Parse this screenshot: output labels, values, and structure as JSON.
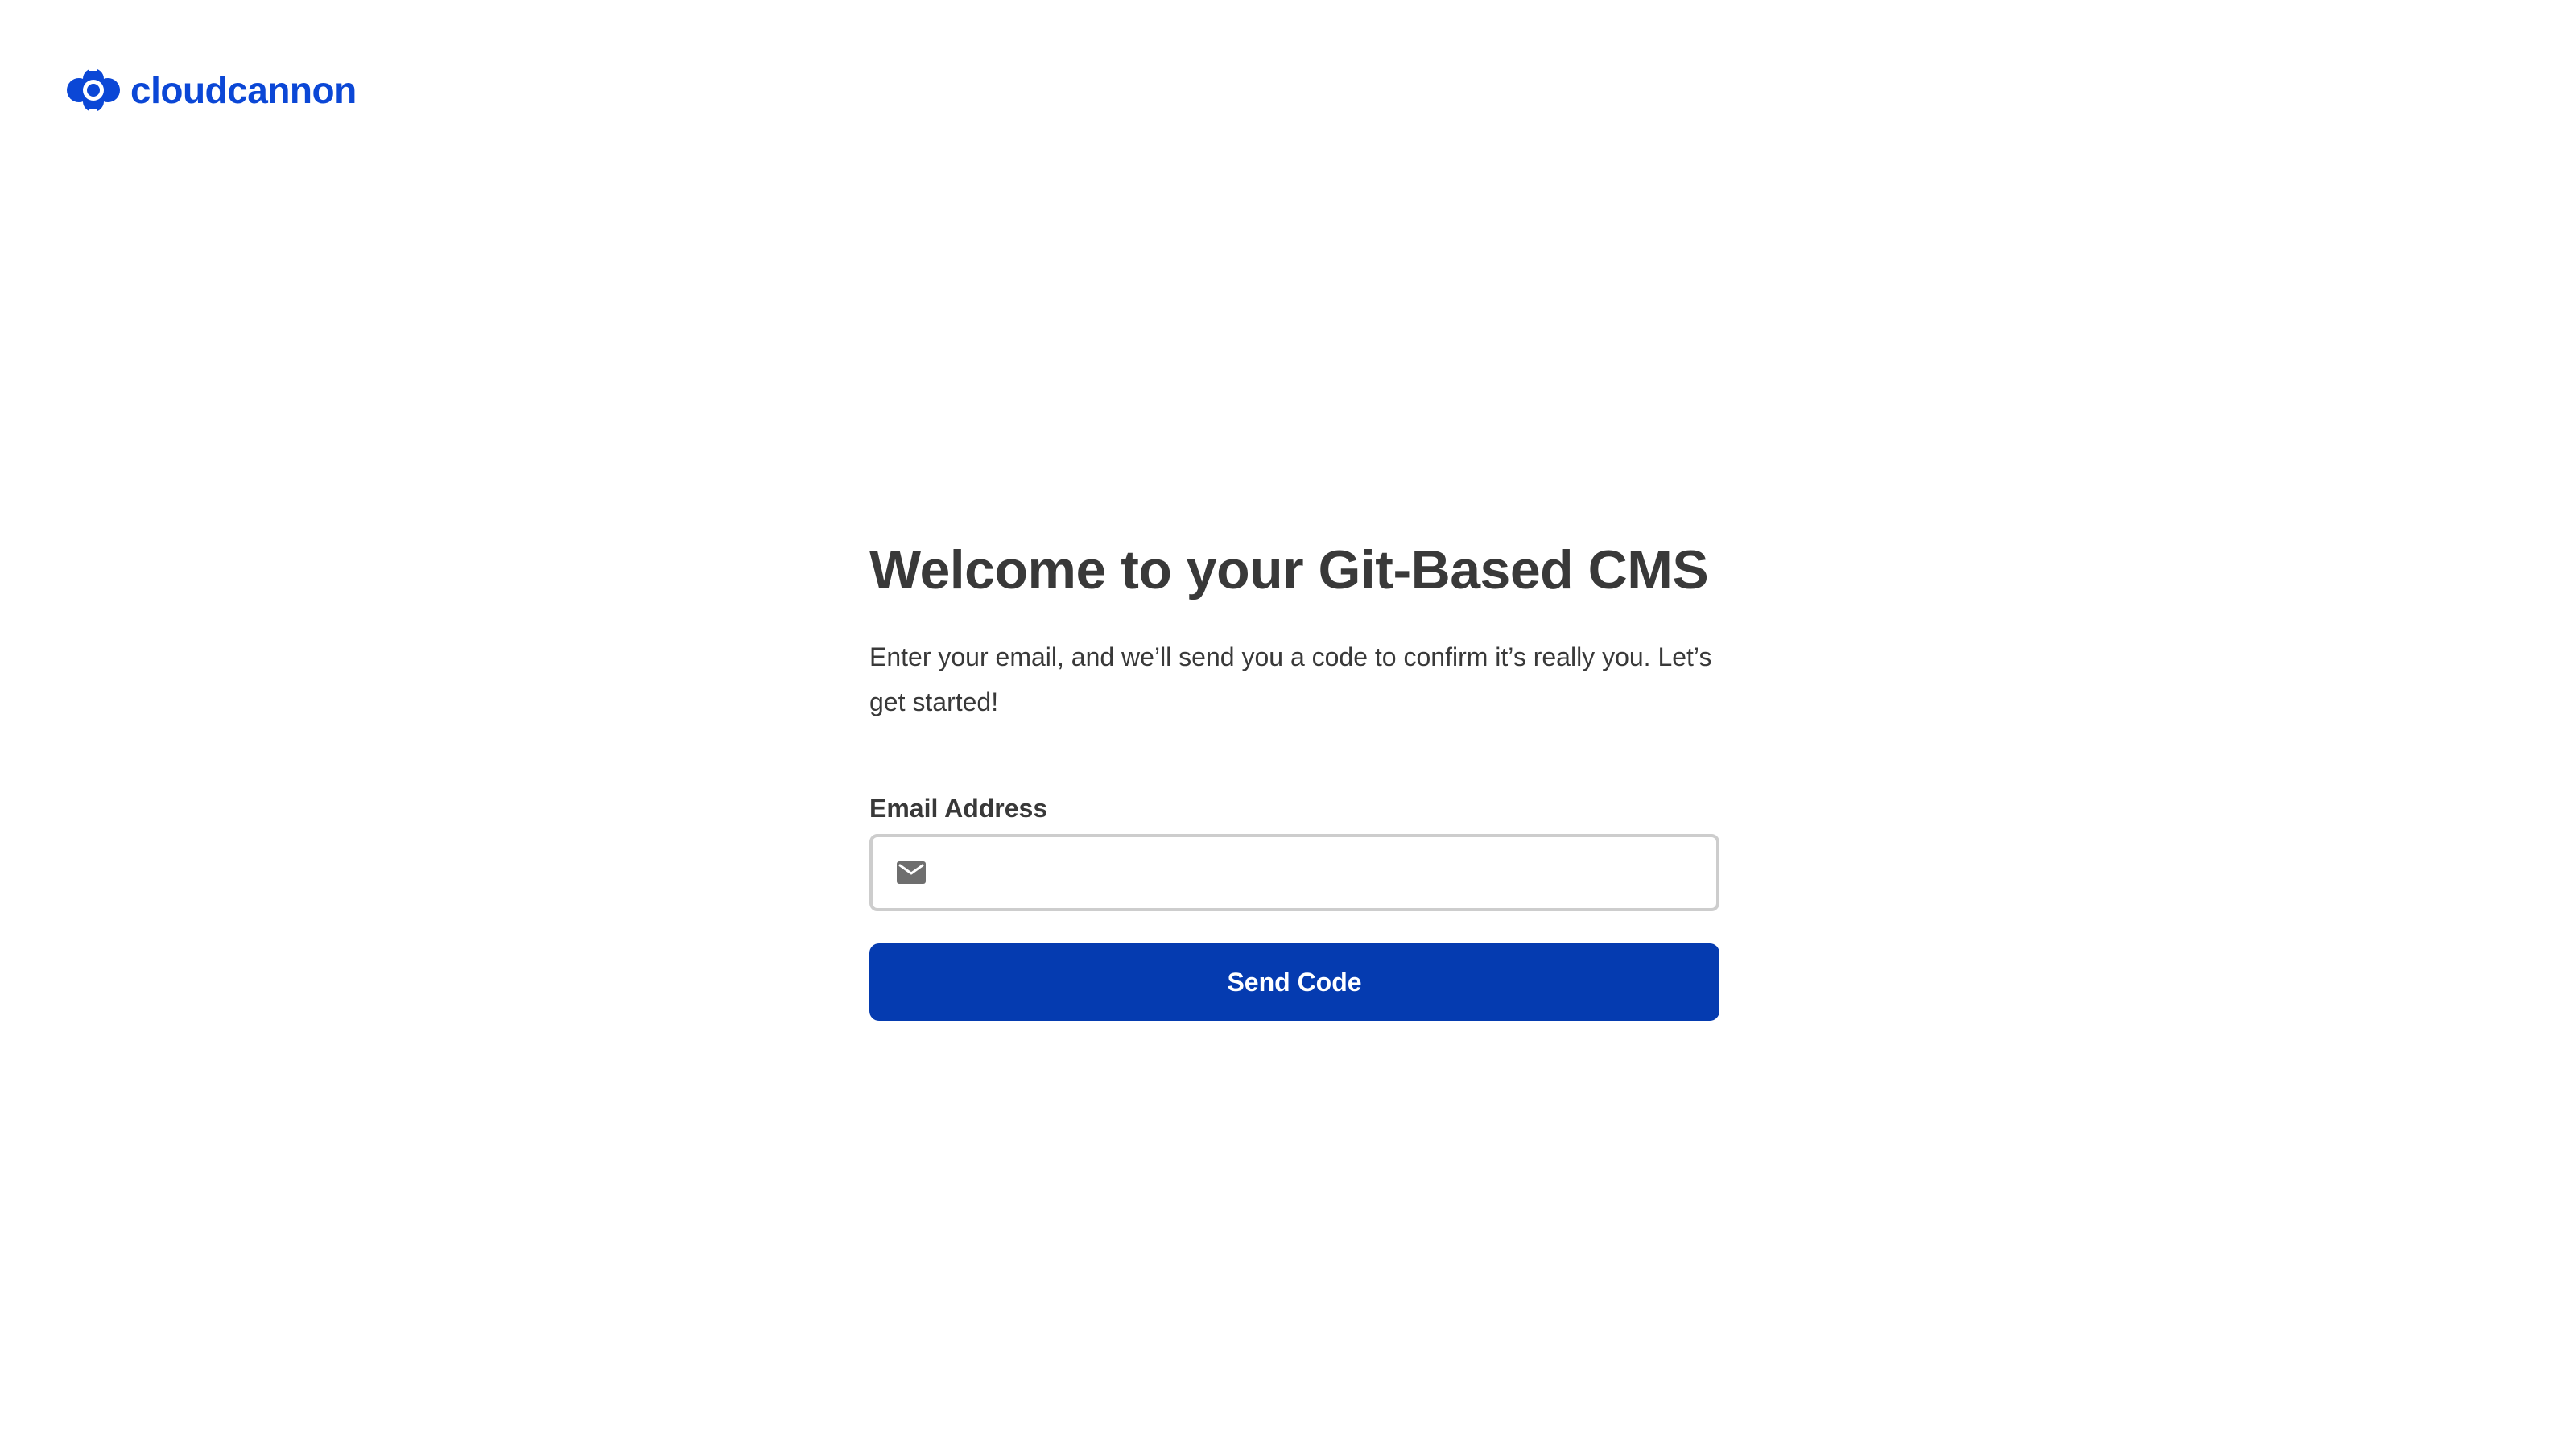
{
  "brand": {
    "name": "cloudcannon",
    "color": "#0b47d6",
    "logo_icon": "cloudcannon-logo-icon"
  },
  "login": {
    "title": "Welcome to your Git-Based CMS",
    "lead": "Enter your email, and we’ll send you a code to confirm it’s really you. Let’s get started!",
    "email_label": "Email Address",
    "email_value": "",
    "email_placeholder": "",
    "email_icon": "mail-icon",
    "send_button_label": "Send Code",
    "button_color": "#053bb0"
  }
}
